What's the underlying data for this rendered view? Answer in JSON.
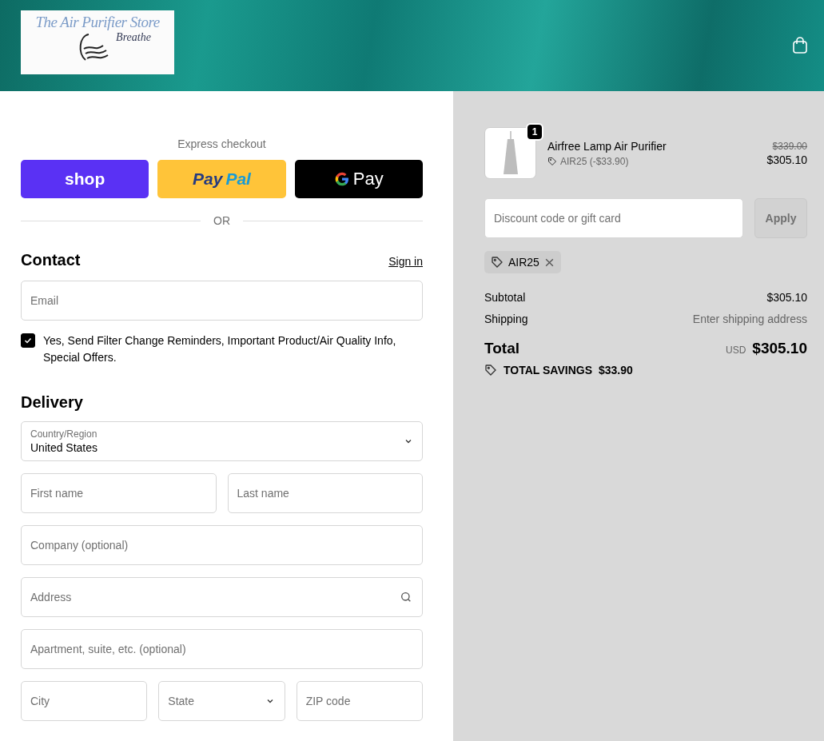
{
  "header": {
    "logo_title": "The Air Purifier Store",
    "logo_tagline": "Breathe"
  },
  "express": {
    "heading": "Express checkout",
    "buttons": [
      {
        "kind": "shop",
        "parts": [
          "shop"
        ]
      },
      {
        "kind": "paypal",
        "parts": [
          "Pay",
          "Pal"
        ]
      },
      {
        "kind": "gpay",
        "parts": [
          "Pay"
        ]
      }
    ],
    "divider": "OR"
  },
  "contact": {
    "heading": "Contact",
    "sign_in": "Sign in",
    "email_placeholder": "Email",
    "consent": {
      "label": "Yes, Send Filter Change Reminders, Important Product/Air Quality Info, Special Offers.",
      "checked": true
    }
  },
  "delivery": {
    "heading": "Delivery",
    "country": {
      "label": "Country/Region",
      "value": "United States"
    },
    "rows": [
      [
        {
          "kind": "text",
          "placeholder": "First name"
        },
        {
          "kind": "text",
          "placeholder": "Last name"
        }
      ],
      [
        {
          "kind": "text",
          "placeholder": "Company (optional)"
        }
      ],
      [
        {
          "kind": "search",
          "placeholder": "Address"
        }
      ],
      [
        {
          "kind": "text",
          "placeholder": "Apartment, suite, etc. (optional)"
        }
      ],
      [
        {
          "kind": "text",
          "placeholder": "City"
        },
        {
          "kind": "select",
          "placeholder": "State"
        },
        {
          "kind": "text",
          "placeholder": "ZIP code"
        }
      ]
    ]
  },
  "summary": {
    "item": {
      "quantity": "1",
      "name": "Airfree Lamp Air Purifier",
      "discount": "AIR25 (-$33.90)",
      "original_price": "$339.00",
      "price": "$305.10"
    },
    "discount_placeholder": "Discount code or gift card",
    "apply": "Apply",
    "applied_code": "AIR25",
    "lines": [
      {
        "label": "Subtotal",
        "value": "$305.10",
        "kind": "amount"
      },
      {
        "label": "Shipping",
        "value": "Enter shipping address",
        "kind": "note"
      }
    ],
    "total": {
      "label": "Total",
      "currency": "USD",
      "amount": "$305.10"
    },
    "savings": {
      "label": "TOTAL SAVINGS",
      "amount": "$33.90"
    }
  }
}
